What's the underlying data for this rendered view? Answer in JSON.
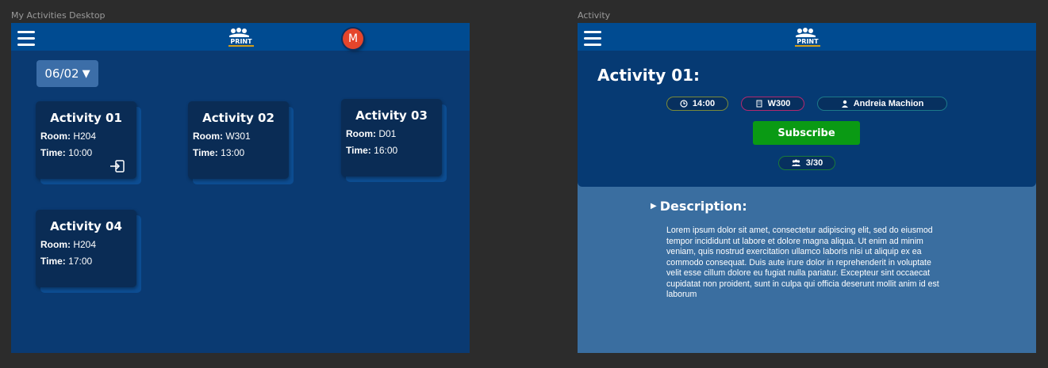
{
  "frames": {
    "left_label": "My Activities Desktop",
    "right_label": "Activity"
  },
  "left": {
    "logo_text": "PRINT",
    "avatar_initial": "M",
    "date_filter": "06/02",
    "cards": [
      {
        "title": "Activity 01",
        "room_label": "Room:",
        "room": "H204",
        "time_label": "Time:",
        "time": "10:00",
        "icon": "enter-icon"
      },
      {
        "title": "Activity 02",
        "room_label": "Room:",
        "room": "W301",
        "time_label": "Time:",
        "time": "13:00"
      },
      {
        "title": "Activity 03",
        "room_label": "Room:",
        "room": "D01",
        "time_label": "Time:",
        "time": "16:00"
      },
      {
        "title": "Activity 04",
        "room_label": "Room:",
        "room": "H204",
        "time_label": "Time:",
        "time": "17:00"
      }
    ]
  },
  "right": {
    "logo_text": "PRINT",
    "title": "Activity 01:",
    "time_chip": "14:00",
    "room_chip": "W300",
    "host_chip": "Andreia Machion",
    "subscribe_label": "Subscribe",
    "capacity": "3/30",
    "description_heading": "Description:",
    "description": "Lorem ipsum dolor sit amet, consectetur adipiscing elit, sed do eiusmod tempor incididunt ut labore et dolore magna aliqua. Ut enim ad minim veniam, quis nostrud exercitation ullamco laboris nisi ut aliquip ex ea commodo consequat. Duis aute irure dolor in reprehenderit in voluptate velit esse cillum dolore eu fugiat nulla pariatur. Excepteur sint occaecat cupidatat non proident, sunt in culpa qui officia deserunt mollit anim id est laborum"
  },
  "colors": {
    "canvas": "#2c2c2c",
    "topbar": "#004b91",
    "card": "#0a2c55",
    "avatar": "#e5452b",
    "subscribe": "#0a9a14",
    "time_chip_border": "#7a8a3a",
    "room_chip_border": "#b3286e",
    "host_chip_border": "#1c7a8a",
    "capacity_chip_border": "#1a7a3a"
  }
}
